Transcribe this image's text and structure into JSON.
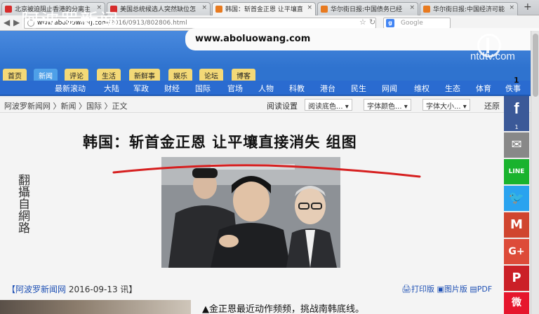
{
  "browser": {
    "tabs": [
      {
        "title": "北京被迫阻止香港的分离主",
        "color": "#d62c2c"
      },
      {
        "title": "美国总统候选人突然缺位怎",
        "color": "#d62c2c"
      },
      {
        "title": "韩国：斩首金正恩 让平壤直",
        "color": "#e87a1f"
      },
      {
        "title": "华尔街日报:中国债务已经",
        "color": "#e87a1f"
      },
      {
        "title": "华尔街日报:中国经济可能",
        "color": "#e87a1f"
      }
    ],
    "new_tab": "+",
    "back": "◀",
    "forward": "▶",
    "url_domain": "www.aboluowang.com",
    "url_path": "/2016/0913/802806.html",
    "search_engine": "g",
    "search_placeholder": "Google"
  },
  "site": {
    "name": "阿波罗新闻",
    "domain": "www.aboluowang.com",
    "top_nav": [
      "首页",
      "新闻",
      "评论",
      "生活",
      "新鲜事",
      "娱乐",
      "论坛",
      "博客"
    ],
    "active_top": "新闻",
    "categories": [
      "最新滚动",
      "大陆",
      "军政",
      "财经",
      "国际",
      "官场",
      "人物",
      "科教",
      "港台",
      "民生",
      "网闻",
      "维权",
      "生态",
      "体育",
      "佚事"
    ],
    "breadcrumb": "阿波罗新闻网 〉新闻 〉国际 〉正文",
    "reading_settings": "阅读设置",
    "dropdowns": [
      "阅读底色...",
      "字体颜色...",
      "字体大小..."
    ],
    "restore": "还原"
  },
  "watermark": {
    "text": "ntdtv.com"
  },
  "article": {
    "headline": "韩国：斩首金正恩 让平壤直接消失 组图",
    "vertical_caption": "翻攝自網路",
    "dateline_source": "【阿波罗新闻网",
    "dateline_date": "2016-09-13 讯】",
    "print_links": "🖨打印版 ▣图片版 ▤PDF",
    "teaser": "▲金正恩最近动作频频，挑战南韩底线。"
  },
  "share": {
    "count": "1",
    "facebook_count": "1",
    "buttons": [
      {
        "name": "facebook",
        "glyph": "f",
        "color": "#3b5998"
      },
      {
        "name": "email",
        "glyph": "✉",
        "color": "#888888"
      },
      {
        "name": "line",
        "glyph": "LINE",
        "color": "#19b32e"
      },
      {
        "name": "twitter",
        "glyph": "🐦",
        "color": "#2aa3ef"
      },
      {
        "name": "gmail",
        "glyph": "M",
        "color": "#d0452f"
      },
      {
        "name": "google-plus",
        "glyph": "G+",
        "color": "#dd4b39"
      },
      {
        "name": "pinterest",
        "glyph": "P",
        "color": "#cb2027"
      },
      {
        "name": "weibo",
        "glyph": "微",
        "color": "#e6162d"
      }
    ]
  }
}
